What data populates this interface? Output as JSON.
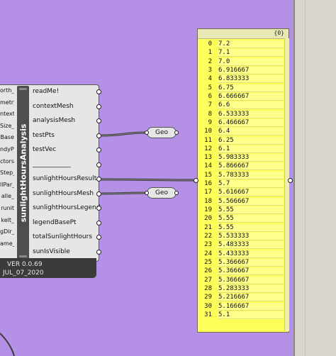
{
  "component": {
    "title": "sunlightHoursAnalysis",
    "version": "VER 0.0.69",
    "date": "JUL_07_2020",
    "inputs": [
      "orth_",
      "metry",
      "ntext_",
      "Size_",
      "Base",
      "ndyP_",
      "ctors",
      "Step_",
      "llPar_",
      "alle_",
      "runit",
      "kelt_",
      "gDir_",
      "ame_"
    ],
    "outputs": [
      "readMe!",
      "contextMesh",
      "analysisMesh",
      "testPts",
      "testVec",
      "____________",
      "sunlightHoursResult",
      "sunlightHoursMesh",
      "sunlightHoursLegend",
      "legendBasePt",
      "totalSunlightHours",
      "sunIsVisible"
    ]
  },
  "relays": {
    "top_label": "Geo",
    "bottom_label": "Geo"
  },
  "panel": {
    "header": "{0}",
    "rows": [
      {
        "i": "0",
        "v": "7.2"
      },
      {
        "i": "1",
        "v": "7.1"
      },
      {
        "i": "2",
        "v": "7.0"
      },
      {
        "i": "3",
        "v": "6.916667"
      },
      {
        "i": "4",
        "v": "6.833333"
      },
      {
        "i": "5",
        "v": "6.75"
      },
      {
        "i": "6",
        "v": "6.666667"
      },
      {
        "i": "7",
        "v": "6.6"
      },
      {
        "i": "8",
        "v": "6.533333"
      },
      {
        "i": "9",
        "v": "6.466667"
      },
      {
        "i": "10",
        "v": "6.4"
      },
      {
        "i": "11",
        "v": "6.25"
      },
      {
        "i": "12",
        "v": "6.1"
      },
      {
        "i": "13",
        "v": "5.983333"
      },
      {
        "i": "14",
        "v": "5.866667"
      },
      {
        "i": "15",
        "v": "5.783333"
      },
      {
        "i": "16",
        "v": "5.7"
      },
      {
        "i": "17",
        "v": "5.616667"
      },
      {
        "i": "18",
        "v": "5.566667"
      },
      {
        "i": "19",
        "v": "5.55"
      },
      {
        "i": "20",
        "v": "5.55"
      },
      {
        "i": "21",
        "v": "5.55"
      },
      {
        "i": "22",
        "v": "5.533333"
      },
      {
        "i": "23",
        "v": "5.483333"
      },
      {
        "i": "24",
        "v": "5.433333"
      },
      {
        "i": "25",
        "v": "5.366667"
      },
      {
        "i": "26",
        "v": "5.366667"
      },
      {
        "i": "27",
        "v": "5.366667"
      },
      {
        "i": "28",
        "v": "5.283333"
      },
      {
        "i": "29",
        "v": "5.216667"
      },
      {
        "i": "30",
        "v": "5.166667"
      },
      {
        "i": "31",
        "v": "5.1"
      }
    ]
  }
}
